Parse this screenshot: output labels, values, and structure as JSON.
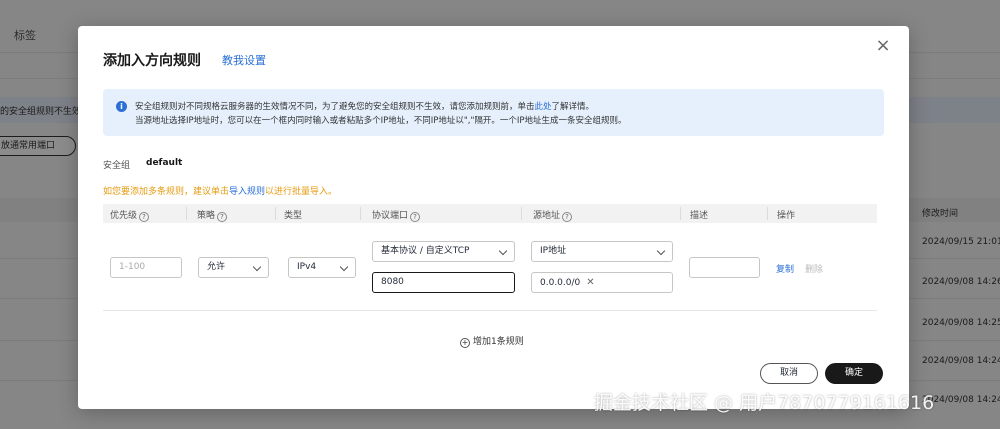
{
  "background": {
    "tab_label": "标签",
    "info_text": "的安全组规则不生效",
    "button_label": "放通常用端口",
    "column_header": "修改时间",
    "times": [
      "2024/09/15 21:01:",
      "2024/09/08 14:26:",
      "2024/09/08 14:25:",
      "2024/09/08 14:24:",
      "2024/09/08 14:24:"
    ]
  },
  "dialog": {
    "title": "添加入方向规则",
    "tutorial_link": "教我设置",
    "close_symbol": "×",
    "alert": {
      "line1_a": "安全组规则对不同规格云服务器的生效情况不同，为了避免您的安全组规则不生效，请您添加规则前，单击",
      "line1_link": "此处",
      "line1_b": "了解详情。",
      "line2": "当源地址选择IP地址时，您可以在一个框内同时输入或者粘贴多个IP地址，不同IP地址以\",\"隔开。一个IP地址生成一条安全组规则。"
    },
    "security_group_label": "安全组",
    "security_group_value": "default",
    "tip": {
      "a": "如您要添加多条规则，建议单击",
      "link": "导入规则",
      "b": "以进行批量导入。"
    },
    "columns": {
      "priority": "优先级",
      "policy": "策略",
      "type": "类型",
      "protocol_port": "协议端口",
      "source": "源地址",
      "description": "描述",
      "operation": "操作"
    },
    "row": {
      "priority_placeholder": "1-100",
      "policy": "允许",
      "type": "IPv4",
      "protocol": "基本协议 / 自定义TCP",
      "port": "8080",
      "source_type": "IP地址",
      "source_tag": "0.0.0.0/0",
      "description": "",
      "copy": "复制",
      "delete": "删除"
    },
    "add_rule": "增加1条规则",
    "cancel": "取消",
    "confirm": "确定"
  },
  "watermark": "掘金技术社区 @ 用户7870779161616"
}
